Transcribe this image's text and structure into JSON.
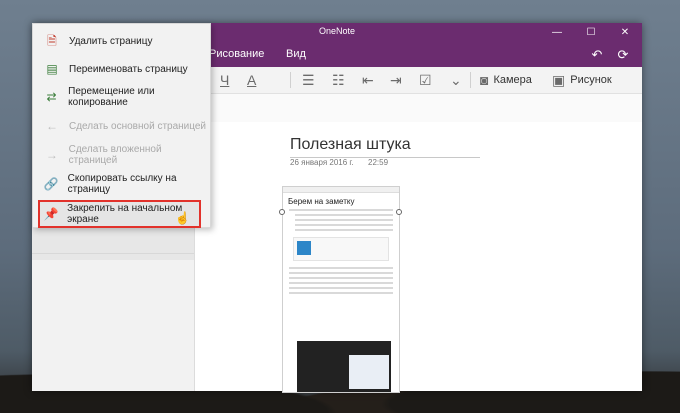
{
  "window": {
    "title": "OneNote"
  },
  "tabs": [
    {
      "label": "Рисование"
    },
    {
      "label": "Вид"
    }
  ],
  "ribbon": {
    "camera": "Камера",
    "picture": "Рисунок",
    "underline": "Ч",
    "font_color": "A"
  },
  "page": {
    "title": "Полезная штука",
    "date": "26 января 2016 г.",
    "time": "22:59",
    "embedded_heading": "Берем на заметку"
  },
  "context_menu": {
    "items": [
      {
        "label": "Удалить страницу",
        "icon": "delete-page-icon",
        "enabled": true
      },
      {
        "label": "Переименовать страницу",
        "icon": "rename-icon",
        "enabled": true
      },
      {
        "label": "Перемещение или копирование",
        "icon": "move-copy-icon",
        "enabled": true
      },
      {
        "label": "Сделать основной страницей",
        "icon": "promote-icon",
        "enabled": false
      },
      {
        "label": "Сделать вложенной страницей",
        "icon": "demote-icon",
        "enabled": false
      },
      {
        "label": "Скопировать ссылку на страницу",
        "icon": "copy-link-icon",
        "enabled": true
      },
      {
        "label": "Закрепить на начальном экране",
        "icon": "pin-icon",
        "enabled": true,
        "highlighted": true
      }
    ]
  },
  "colors": {
    "accent": "#6b2c6f",
    "highlight": "#e2322b"
  }
}
